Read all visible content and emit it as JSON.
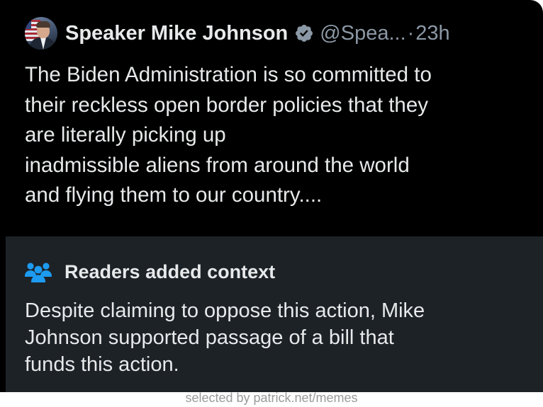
{
  "tweet": {
    "author_name": "Speaker Mike Johnson",
    "handle": "@Spea...",
    "separator": "·",
    "time": "23h",
    "text_lines": [
      "The Biden Administration is so committed to",
      "their reckless open border policies that they",
      "are literally picking up",
      "inadmissible aliens from around the world",
      "and flying them to our country...."
    ],
    "verified_icon": "verified-badge-icon",
    "verified_color": "#8b98a5"
  },
  "context_note": {
    "title": "Readers added context",
    "icon": "people-icon",
    "icon_color": "#1d9bf0",
    "text_lines": [
      "Despite claiming to oppose this action, Mike",
      "Johnson supported passage of a bill that",
      "funds this action."
    ]
  },
  "watermark": "selected by patrick.net/memes",
  "colors": {
    "background": "#000000",
    "context_background": "#1d2227",
    "text": "#e7e9ea",
    "muted": "#8b98a5"
  }
}
